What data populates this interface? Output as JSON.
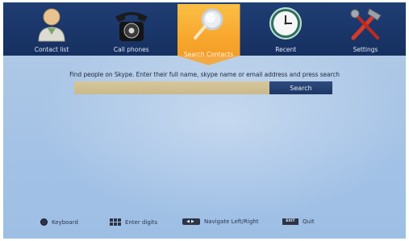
{
  "nav": {
    "items": [
      {
        "label": "Contact list",
        "icon": "contact-person-icon"
      },
      {
        "label": "Call phones",
        "icon": "telephone-icon"
      },
      {
        "label": "Search Contacts",
        "icon": "magnifier-icon",
        "active": true
      },
      {
        "label": "Recent",
        "icon": "clock-icon"
      },
      {
        "label": "Settings",
        "icon": "tools-icon"
      }
    ]
  },
  "search": {
    "prompt": "Find people on Skype. Enter their full name, skype name or email address and press search",
    "value": "",
    "button_label": "Search"
  },
  "help": {
    "keyboard": "Keyboard",
    "digits": "Enter digits",
    "navigate": "Navigate Left/Right",
    "exit_key": "EXIT",
    "quit": "Quit"
  },
  "colors": {
    "topbar": "#1a3568",
    "active_tab": "#f7a52c",
    "screen_bg": "#aac6e6",
    "search_field": "#cdbd8f",
    "search_button": "#254373"
  }
}
